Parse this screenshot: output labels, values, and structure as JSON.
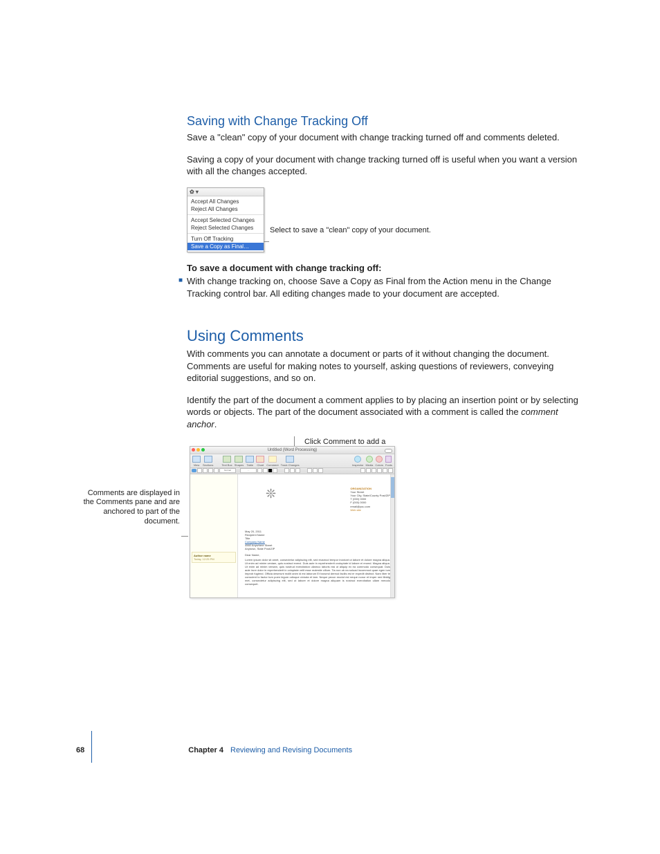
{
  "section1": {
    "heading": "Saving with Change Tracking Off",
    "p1": "Save a \"clean\" copy of your document with change tracking turned off and comments deleted.",
    "p2": "Saving a copy of your document with change tracking turned off is useful when you want a version with all the changes accepted."
  },
  "action_menu": {
    "header": "✿ ▾",
    "group1": [
      "Accept All Changes",
      "Reject All Changes"
    ],
    "group2": [
      "Accept Selected Changes",
      "Reject Selected Changes"
    ],
    "group3": [
      "Turn Off Tracking",
      "Save a Copy as Final…"
    ],
    "callout": "Select to save a \"clean\" copy of your document."
  },
  "howto": {
    "heading": "To save a document with change tracking off:",
    "bullet": "With change tracking on, choose Save a Copy as Final from the Action menu in the Change Tracking control bar. All editing changes made to your document are accepted."
  },
  "section2": {
    "heading": "Using Comments",
    "p1": "With comments you can annotate a document or parts of it without changing the document. Comments are useful for making notes to yourself, asking questions of reviewers, conveying editorial suggestions, and so on.",
    "p2_a": "Identify the part of the document a comment applies to by placing an insertion point or by selecting words or objects. The part of the document associated with a comment is called the ",
    "p2_em": "comment anchor",
    "p2_b": "."
  },
  "fig2": {
    "top_callout": "Click Comment to add a comment to your document.",
    "left_callout": "Comments are displayed in the Comments pane and are anchored to part of the document.",
    "window_title": "Untitled (Word Processing)",
    "toolbar": {
      "view": "View",
      "sections": "Sections",
      "textbox": "Text Box",
      "shapes": "Shapes",
      "table": "Table",
      "chart": "Chart",
      "comment": "Comment",
      "track": "Track Changes",
      "inspector": "Inspector",
      "media": "Media",
      "colors": "Colors",
      "fonts": "Fonts"
    },
    "fmt": {
      "style": "Normal",
      "font": "…"
    },
    "comment_card": {
      "name": "Author name",
      "time": "Today, 12:25 PM"
    },
    "letterhead": {
      "l1": "Your Street",
      "l2": "Your City, State/County Post/ZIP",
      "l3": "T (000) 0000",
      "l4": "F (000) 0000",
      "l5": "email@you.com",
      "l6": "Web site"
    },
    "letter": {
      "date": "May 20, 2011",
      "to1": "Recipient Name",
      "to2": "Title",
      "to3": "Company Name",
      "to4": "4560 Anywhere Street",
      "to5": "Anytown, State Post/ZIP",
      "greet": "Dear Name,",
      "body": "Lorem ipsum dolor sit amet, consectetur adipiscing elit, sed eiusmod tempor incidunt ut labore et dolore magna aliqua. Ut enim ad minim veniam, quis nostrud exerci. Duis aute in reprehenderit cvoluptate id labore ei reumd. Magna aliqua. Ut enim ad minim veniam, quis nostrud exercitation ullamco laboris nisi ut aliquip ex ea commodo consequat. Duis aute irure dolor in reprehenderit in voluptate velit esse molestie cillum. Tia non ob ea soluad incommod quae egen ium improb fugiend. Officia deserunt mollit anim id est laborum Et harumd dereud facilis est er expedit distinct. Nam liber te conscient to factor tum poen legum odioque civiuda et tam. Neque pecun modut est neque nonor et imper ned libidig met, consectetur adipiscing elit, sed ut labore et dolore magna aliquam is nostrud exercitation ullam mmodo consequet."
    }
  },
  "footer": {
    "page": "68",
    "chapter": "Chapter 4",
    "title": "Reviewing and Revising Documents"
  }
}
